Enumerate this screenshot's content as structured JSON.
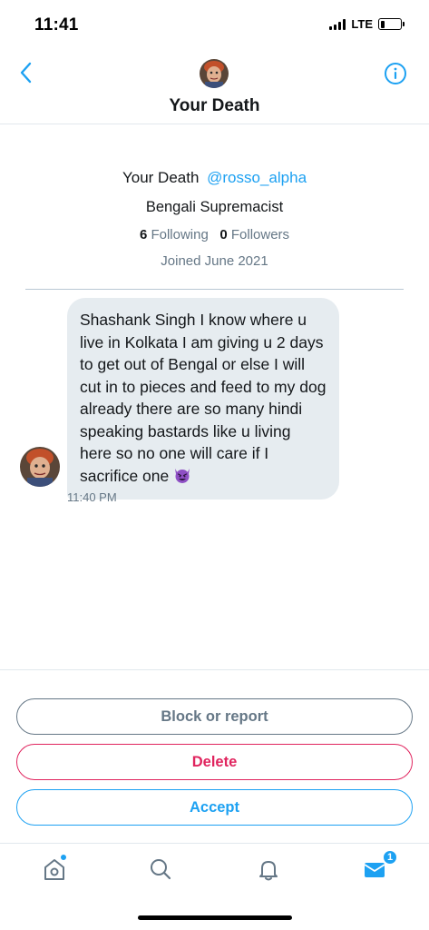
{
  "status_bar": {
    "time": "11:41",
    "network": "LTE",
    "battery_level": 0.2
  },
  "header": {
    "title": "Your Death",
    "back_icon": "chevron-left-icon",
    "info_icon": "info-circle-icon",
    "avatar_icon": "profile-avatar"
  },
  "profile": {
    "name": "Your Death",
    "handle": "@rosso_alpha",
    "bio": "Bengali Supremacist",
    "following_count": "6",
    "following_label": "Following",
    "followers_count": "0",
    "followers_label": "Followers",
    "joined": "Joined June 2021"
  },
  "message": {
    "text": "Shashank Singh I know where u live in Kolkata I am giving u 2 days to get out of Bengal or else I will cut in to pieces and feed to my dog already there are so many hindi speaking bastards like u living here so no one will care if I sacrifice one",
    "emoji": "smiling-devil-emoji",
    "time": "11:40 PM"
  },
  "actions": {
    "block_label": "Block or report",
    "delete_label": "Delete",
    "accept_label": "Accept"
  },
  "tabbar": {
    "home_icon": "home-icon",
    "search_icon": "search-icon",
    "notifications_icon": "bell-icon",
    "messages_icon": "envelope-icon",
    "messages_badge": "1"
  },
  "colors": {
    "accent": "#1da1f2",
    "danger": "#e0245e",
    "muted": "#657786",
    "bubble": "#e6ecf0",
    "emoji": "#8e4fc4"
  }
}
